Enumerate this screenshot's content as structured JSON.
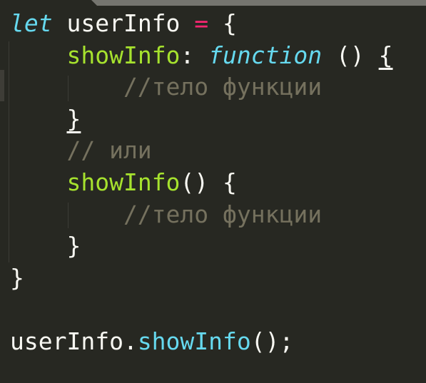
{
  "editor": {
    "lines": [
      [
        {
          "t": "let",
          "c": "kw"
        },
        {
          "t": " userInfo ",
          "c": "plain"
        },
        {
          "t": "=",
          "c": "op"
        },
        {
          "t": " {",
          "c": "plain"
        }
      ],
      [
        {
          "t": "    ",
          "c": "plain"
        },
        {
          "t": "showInfo",
          "c": "fn"
        },
        {
          "t": ": ",
          "c": "plain"
        },
        {
          "t": "function",
          "c": "kw"
        },
        {
          "t": " () ",
          "c": "plain"
        },
        {
          "t": "{",
          "c": "plain u"
        }
      ],
      [
        {
          "t": "        //тело функции",
          "c": "cm"
        }
      ],
      [
        {
          "t": "    ",
          "c": "plain"
        },
        {
          "t": "}",
          "c": "plain u"
        }
      ],
      [
        {
          "t": "    // или",
          "c": "cm"
        }
      ],
      [
        {
          "t": "    ",
          "c": "plain"
        },
        {
          "t": "showInfo",
          "c": "fn"
        },
        {
          "t": "() {",
          "c": "plain"
        }
      ],
      [
        {
          "t": "        //тело функции",
          "c": "cm"
        }
      ],
      [
        {
          "t": "    }",
          "c": "plain"
        }
      ],
      [
        {
          "t": "}",
          "c": "plain"
        }
      ],
      [],
      [
        {
          "t": "userInfo.",
          "c": "plain"
        },
        {
          "t": "showInfo",
          "c": "call"
        },
        {
          "t": "();",
          "c": "plain"
        }
      ]
    ]
  }
}
